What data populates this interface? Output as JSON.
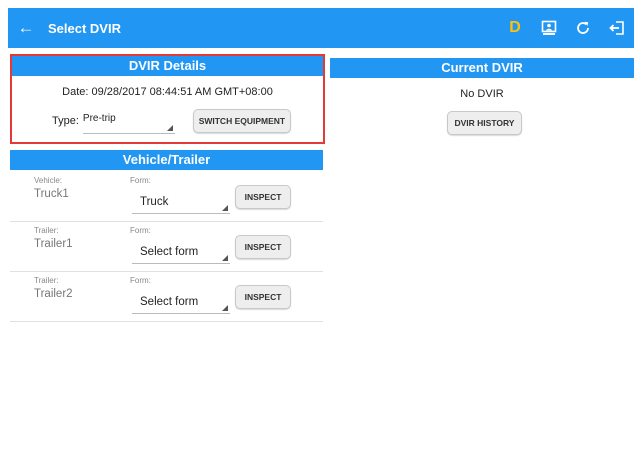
{
  "appbar": {
    "title": "Select DVIR",
    "back_icon": "arrow-left",
    "badge": "D",
    "badge_color": "#FFC107",
    "accent_color": "#2196F3",
    "actions": [
      "account-box-icon",
      "refresh-icon",
      "logout-icon"
    ]
  },
  "details": {
    "header": "DVIR Details",
    "date_line": "Date: 09/28/2017 08:44:51 AM GMT+08:00",
    "type_label": "Type:",
    "type_value": "Pre-trip",
    "switch_button": "SWITCH EQUIPMENT",
    "highlight_color": "#E53935"
  },
  "vehicle_trailer": {
    "header": "Vehicle/Trailer",
    "rows": [
      {
        "kind": "Vehicle:",
        "name": "Truck1",
        "form_label": "Form:",
        "form_value": "Truck",
        "button": "INSPECT"
      },
      {
        "kind": "Trailer:",
        "name": "Trailer1",
        "form_label": "Form:",
        "form_value": "Select form",
        "button": "INSPECT"
      },
      {
        "kind": "Trailer:",
        "name": "Trailer2",
        "form_label": "Form:",
        "form_value": "Select form",
        "button": "INSPECT"
      }
    ]
  },
  "current": {
    "header": "Current DVIR",
    "status": "No DVIR",
    "history_button": "DVIR HISTORY"
  }
}
